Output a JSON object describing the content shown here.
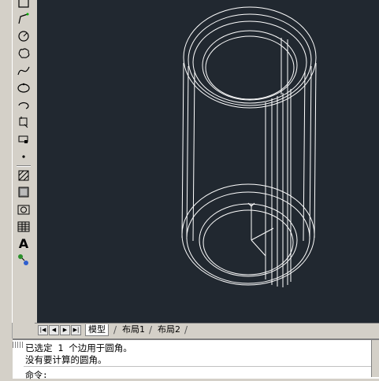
{
  "toolbar": {
    "icons": [
      "rectangle-icon",
      "polyline-icon",
      "circle-icon",
      "revision-cloud-icon",
      "spline-icon",
      "ellipse-icon",
      "ellipse-arc-icon",
      "insert-block-icon",
      "make-block-icon",
      "point-icon",
      "hatch-icon",
      "gradient-icon",
      "region-icon",
      "table-icon",
      "multiline-text-icon",
      "add-selected-icon"
    ],
    "text_tool_label": "A"
  },
  "tabs": {
    "model": "模型",
    "layout1": "布局1",
    "layout2": "布局2"
  },
  "command": {
    "line1": "已选定 1 个边用于圆角。",
    "line2": "没有要计算的圆角。",
    "prompt": "命令:"
  },
  "colors": {
    "canvas_background": "#212830",
    "wireframe": "#ffffff",
    "ui_background": "#d4d0c8"
  }
}
